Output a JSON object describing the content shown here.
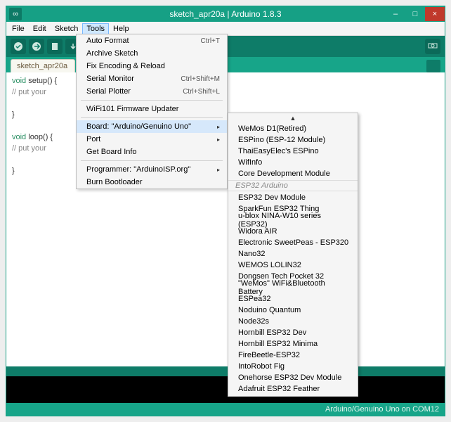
{
  "titlebar": {
    "text": "sketch_apr20a | Arduino 1.8.3",
    "app_glyph": "∞",
    "min": "–",
    "max": "□",
    "close": "×"
  },
  "menubar": {
    "file": "File",
    "edit": "Edit",
    "sketch": "Sketch",
    "tools": "Tools",
    "help": "Help"
  },
  "tab": {
    "label": "sketch_apr20a"
  },
  "code": {
    "l1a": "void",
    "l1b": " setup() {",
    "l2": "  // put your",
    "l3": "}",
    "l4a": "void",
    "l4b": " loop() {",
    "l5": "  // put your",
    "l6": "}"
  },
  "tools": {
    "auto_format": "Auto Format",
    "auto_format_sc": "Ctrl+T",
    "archive": "Archive Sketch",
    "fix_enc": "Fix Encoding & Reload",
    "serial_mon": "Serial Monitor",
    "serial_mon_sc": "Ctrl+Shift+M",
    "serial_plot": "Serial Plotter",
    "serial_plot_sc": "Ctrl+Shift+L",
    "wifi": "WiFi101 Firmware Updater",
    "board": "Board: \"Arduino/Genuino Uno\"",
    "port": "Port",
    "get_info": "Get Board Info",
    "programmer": "Programmer: \"ArduinoISP.org\"",
    "burn": "Burn Bootloader",
    "arrow": "▸"
  },
  "boards": {
    "scroll_up": "▲",
    "items_top": [
      "WeMos D1(Retired)",
      "ESPino (ESP-12 Module)",
      "ThaiEasyElec's ESPino",
      "WifInfo",
      "Core Development Module"
    ],
    "category": "ESP32 Arduino",
    "items": [
      "ESP32 Dev Module",
      "SparkFun ESP32 Thing",
      "u-blox NINA-W10 series (ESP32)",
      "Widora AIR",
      "Electronic SweetPeas - ESP320",
      "Nano32",
      "WEMOS LOLIN32",
      "Dongsen Tech Pocket 32",
      "\"WeMos\" WiFi&Bluetooth Battery",
      "ESPea32",
      "Noduino Quantum",
      "Node32s",
      "Hornbill ESP32 Dev",
      "Hornbill ESP32 Minima",
      "FireBeetle-ESP32",
      "IntoRobot Fig",
      "Onehorse ESP32 Dev Module",
      "Adafruit ESP32 Feather"
    ]
  },
  "status": {
    "text": "Arduino/Genuino Uno on COM12"
  }
}
